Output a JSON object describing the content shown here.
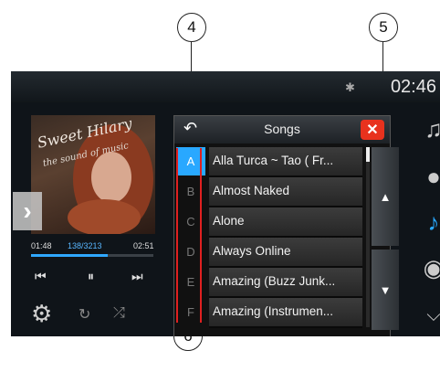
{
  "callouts": {
    "c4": "4",
    "c5": "5",
    "c6": "6"
  },
  "status": {
    "time": "02:46",
    "bt_icon": "bluetooth-icon"
  },
  "album": {
    "title": "Sweet Hilary",
    "subtitle": "the sound of music"
  },
  "player": {
    "elapsed": "01:48",
    "track": "138/3213",
    "total": "02:51",
    "progress_fraction": 0.63
  },
  "list": {
    "title": "Songs",
    "rows": [
      {
        "letter": "A",
        "song": "Alla Turca ~ Tao ( Fr..."
      },
      {
        "letter": "B",
        "song": "Almost Naked"
      },
      {
        "letter": "C",
        "song": "Alone"
      },
      {
        "letter": "D",
        "song": "Always Online"
      },
      {
        "letter": "E",
        "song": "Amazing (Buzz Junk..."
      },
      {
        "letter": "F",
        "song": "Amazing (Instrumen..."
      }
    ]
  },
  "icons": {
    "prev": "skip-previous-icon",
    "pause": "pause-icon",
    "next": "skip-next-icon",
    "settings": "gear-icon",
    "repeat": "repeat-icon",
    "shuffle": "shuffle-icon",
    "sidebar": [
      "playlist-icon",
      "artist-icon",
      "music-note-icon",
      "disc-icon",
      "chevron-double-down-icon"
    ]
  },
  "colors": {
    "accent": "#29a8ff",
    "close": "#e8321e",
    "marker": "#e02020"
  }
}
